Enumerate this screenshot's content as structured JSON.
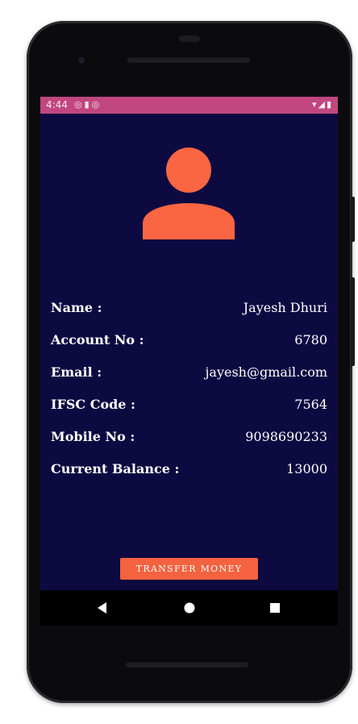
{
  "status_bar": {
    "time": "4:44",
    "left_icons": [
      "sync-icon",
      "sd-card-icon",
      "sync-icon"
    ],
    "right_icons": [
      "wifi-icon",
      "signal-icon",
      "battery-icon"
    ],
    "color": "#c2467f"
  },
  "profile": {
    "avatar_icon": "person-icon",
    "avatar_color": "#fa6641"
  },
  "details": [
    {
      "label": "Name :",
      "value": "Jayesh Dhuri"
    },
    {
      "label": "Account No :",
      "value": "6780"
    },
    {
      "label": "Email :",
      "value": "jayesh@gmail.com"
    },
    {
      "label": "IFSC Code :",
      "value": "7564"
    },
    {
      "label": "Mobile No :",
      "value": "9098690233"
    },
    {
      "label": "Current Balance :",
      "value": "13000"
    }
  ],
  "actions": {
    "transfer_label": "TRANSFER MONEY",
    "button_color": "#f4623f"
  },
  "nav": {
    "back_icon": "back-triangle-icon",
    "home_icon": "home-circle-icon",
    "recents_icon": "recents-square-icon"
  },
  "theme": {
    "background": "#0d0a42"
  }
}
